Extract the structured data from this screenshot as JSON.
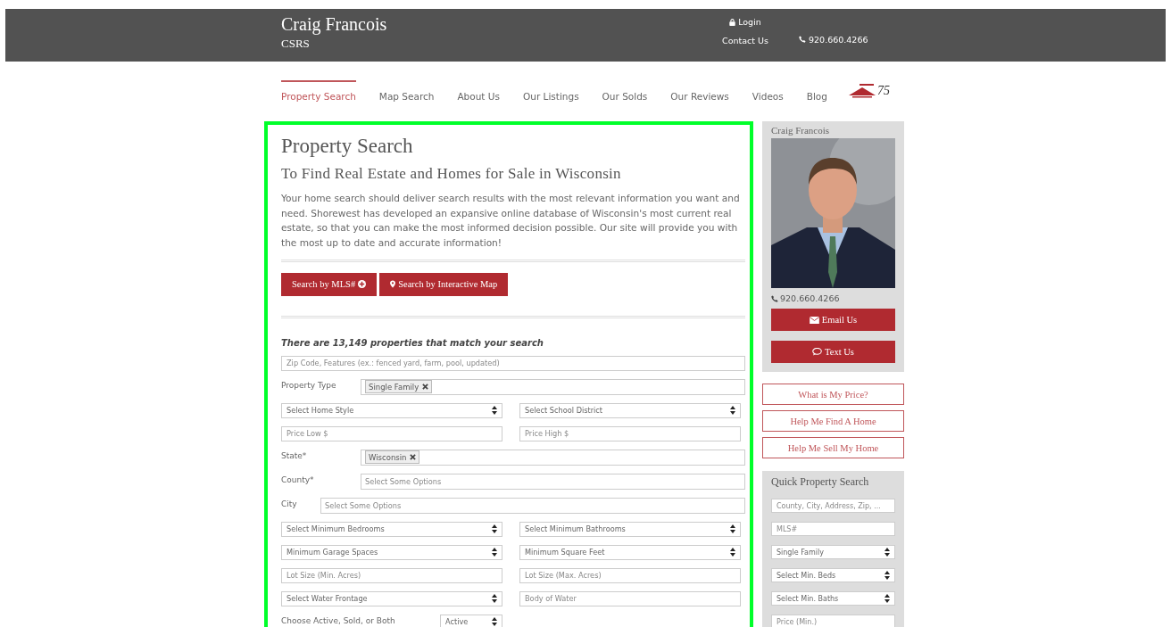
{
  "header": {
    "name": "Craig Francois",
    "credential": "CSRS",
    "login": "Login",
    "contact": "Contact Us",
    "phone": "920.660.4266"
  },
  "nav": {
    "items": [
      {
        "label": "Property Search",
        "selected": true
      },
      {
        "label": "Map Search",
        "selected": false
      },
      {
        "label": "About Us",
        "selected": false
      },
      {
        "label": "Our Listings",
        "selected": false
      },
      {
        "label": "Our Solds",
        "selected": false
      },
      {
        "label": "Our Reviews",
        "selected": false
      },
      {
        "label": "Videos",
        "selected": false
      },
      {
        "label": "Blog",
        "selected": false
      }
    ],
    "logo_badge": "75"
  },
  "main": {
    "title": "Property Search",
    "subtitle": "To Find Real Estate and Homes for Sale in Wisconsin",
    "intro": "Your home search should deliver search results with the most relevant information you want and need. Shorewest has developed an expansive online database of Wisconsin's most current real estate, so that you can make the most informed decision possible. Our site will provide you with the most up to date and accurate information!",
    "buttons": [
      {
        "label": "Search by MLS#",
        "kind": "mls"
      },
      {
        "label": "Search by Interactive Map",
        "kind": "map"
      }
    ],
    "result_count": "There are 13,149 properties that match your search",
    "form": [
      {
        "kind": "text",
        "placeholder": "Zip Code, Features (ex.: fenced yard, farm, pool, updated)"
      },
      {
        "kind": "tags",
        "label": "Property Type",
        "tags": [
          "Single Family"
        ]
      },
      {
        "kind": "pair",
        "fields": [
          {
            "kind": "select",
            "text": "Select Home Style"
          },
          {
            "kind": "select",
            "text": "Select School District"
          }
        ]
      },
      {
        "kind": "pair",
        "fields": [
          {
            "kind": "text",
            "placeholder": "Price Low $"
          },
          {
            "kind": "text",
            "placeholder": "Price High $"
          }
        ]
      },
      {
        "kind": "tags",
        "label": "State*",
        "tags": [
          "Wisconsin"
        ]
      },
      {
        "kind": "options",
        "label": "County*",
        "placeholder": "Select Some Options"
      },
      {
        "kind": "options",
        "label": "City",
        "placeholder": "Select Some Options"
      },
      {
        "kind": "pair",
        "fields": [
          {
            "kind": "select",
            "text": "Select Minimum Bedrooms"
          },
          {
            "kind": "select",
            "text": "Select Minimum Bathrooms"
          }
        ]
      },
      {
        "kind": "pair",
        "fields": [
          {
            "kind": "select",
            "text": "Minimum Garage Spaces"
          },
          {
            "kind": "select",
            "text": "Minimum Square Feet"
          }
        ]
      },
      {
        "kind": "pair",
        "fields": [
          {
            "kind": "text",
            "placeholder": "Lot Size (Min. Acres)"
          },
          {
            "kind": "text",
            "placeholder": "Lot Size (Max. Acres)"
          }
        ]
      },
      {
        "kind": "pair",
        "fields": [
          {
            "kind": "select",
            "text": "Select Water Frontage"
          },
          {
            "kind": "text",
            "placeholder": "Body of Water"
          }
        ]
      },
      {
        "kind": "choice",
        "label": "Choose Active, Sold, or Both",
        "value": "Active"
      }
    ]
  },
  "sidebar": {
    "agent": {
      "name": "Craig Francois",
      "phone": "920.660.4266",
      "buttons": [
        {
          "label": "Email Us",
          "kind": "email"
        },
        {
          "label": "Text Us",
          "kind": "text"
        }
      ]
    },
    "links": [
      "What is My Price?",
      "Help Me Find A Home",
      "Help Me Sell My Home"
    ],
    "quick_search": {
      "title": "Quick Property Search",
      "fields": [
        {
          "kind": "text",
          "placeholder": "County, City, Address, Zip, ..."
        },
        {
          "kind": "text",
          "placeholder": "MLS#"
        },
        {
          "kind": "select",
          "text": "Single Family"
        },
        {
          "kind": "select",
          "text": "Select Min. Beds"
        },
        {
          "kind": "select",
          "text": "Select Min. Baths"
        },
        {
          "kind": "text",
          "placeholder": "Price (Min.)"
        }
      ]
    }
  }
}
